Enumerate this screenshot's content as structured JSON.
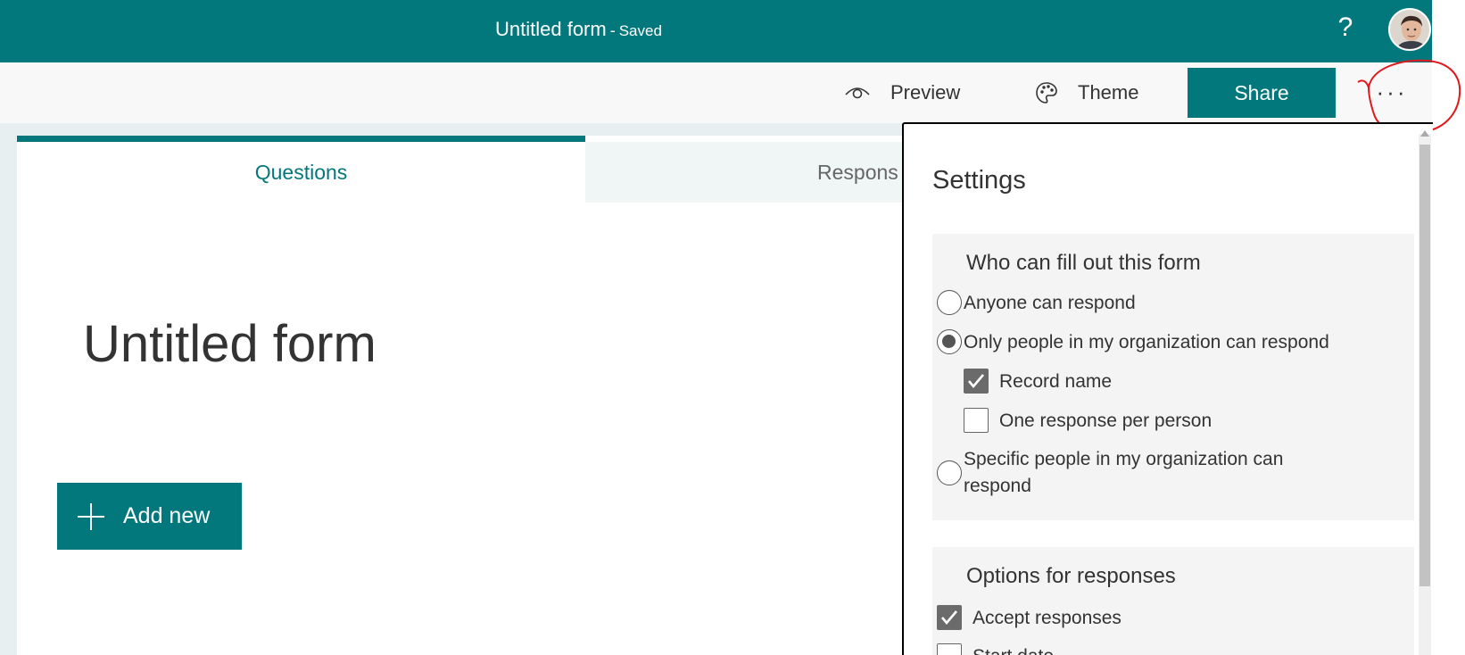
{
  "header": {
    "title": "Untitled form",
    "separator": "-",
    "status": "Saved",
    "help": "?"
  },
  "toolbar": {
    "preview_label": "Preview",
    "theme_label": "Theme",
    "share_label": "Share",
    "more_label": "···"
  },
  "tabs": [
    {
      "label": "Questions",
      "active": true
    },
    {
      "label": "Respons",
      "active": false
    }
  ],
  "form": {
    "title": "Untitled form",
    "add_new_label": "Add new"
  },
  "settings": {
    "title": "Settings",
    "who_section": {
      "heading": "Who can fill out this form",
      "options": [
        {
          "label": "Anyone can respond",
          "selected": false
        },
        {
          "label": "Only people in my organization can respond",
          "selected": true
        },
        {
          "label": "Record name",
          "checked": true
        },
        {
          "label": "One response per person",
          "checked": false
        },
        {
          "label": "Specific people in my organization can respond",
          "selected": false
        }
      ]
    },
    "responses_section": {
      "heading": "Options for responses",
      "options": [
        {
          "label": "Accept responses",
          "checked": true
        },
        {
          "label": "Start date",
          "checked": false
        }
      ]
    }
  },
  "colors": {
    "brand": "#03787c",
    "annotation": "#e0191e"
  }
}
